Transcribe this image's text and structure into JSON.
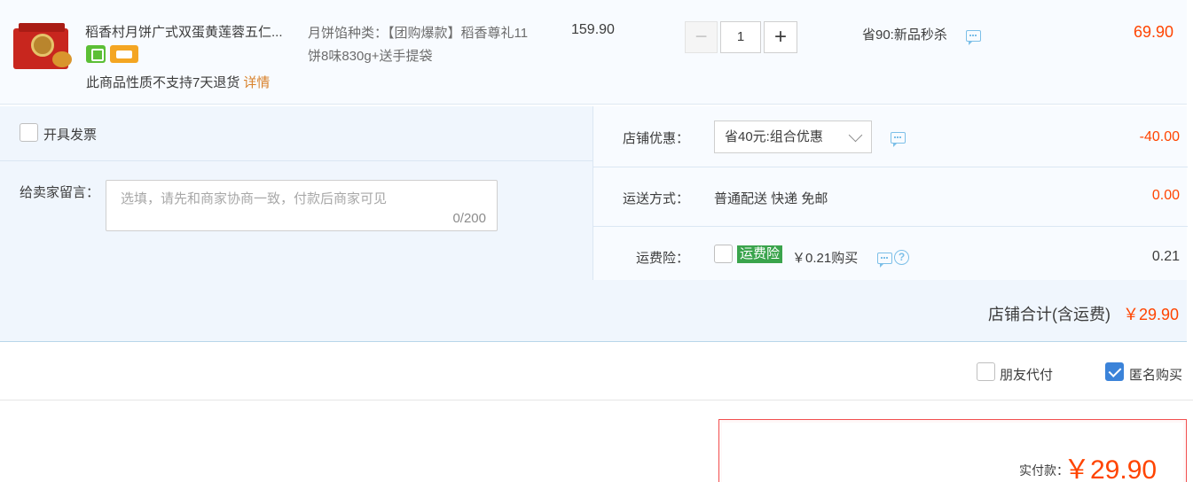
{
  "item": {
    "title": "稻香村月饼广式双蛋黄莲蓉五仁...",
    "return_note": "此商品性质不支持7天退货",
    "details_link": "详情",
    "sku_label": "月饼馅种类：",
    "sku_value": "【团购爆款】稻香尊礼11饼8味830g+送手提袋",
    "unit_price": "159.90",
    "qty_minus": "−",
    "quantity": "1",
    "qty_plus": "+",
    "promo": "省90:新品秒杀",
    "total": "69.90"
  },
  "options": {
    "invoice_label": "开具发票",
    "message_label": "给卖家留言：",
    "message_placeholder": "选填，请先和商家协商一致，付款后商家可见",
    "message_count": "0/200",
    "coupon_label": "店铺优惠：",
    "coupon_value": "省40元:组合优惠",
    "coupon_amount": "-40.00",
    "shipping_label": "运送方式：",
    "shipping_value": "普通配送 快递 免邮",
    "shipping_amount": "0.00",
    "insurance_label": "运费险：",
    "insurance_tag": "运费险",
    "insurance_price": "￥0.21购买",
    "insurance_amount": "0.21",
    "store_total_label": "店铺合计(含运费)",
    "store_total_amount": "￥29.90"
  },
  "payment": {
    "friend_pay_label": "朋友代付",
    "anonymous_label": "匿名购买",
    "anonymous_checked": true,
    "pay_label": "实付款：",
    "pay_amount": "￥29.90"
  },
  "colors": {
    "price_red": "#ff4400",
    "accent_blue": "#3b83d9",
    "insurance_green": "#3aa44c"
  }
}
